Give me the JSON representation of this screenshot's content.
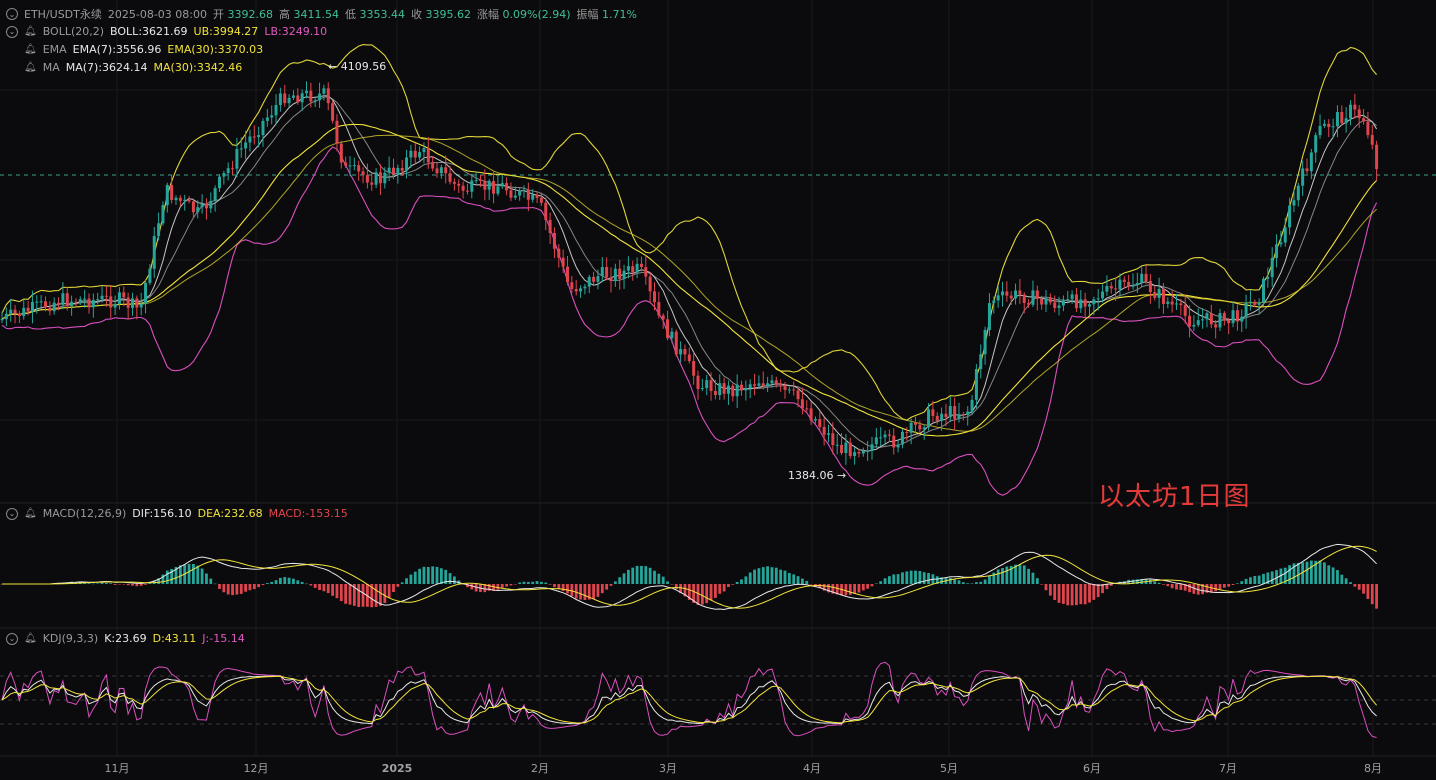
{
  "header": {
    "symbol": "ETH/USDT永续",
    "datetime": "2025-08-03 08:00",
    "open_label": "开",
    "open": "3392.68",
    "high_label": "高",
    "high": "3411.54",
    "low_label": "低",
    "low": "3353.44",
    "close_label": "收",
    "close": "3395.62",
    "change_label": "涨幅",
    "change": "0.09%(2.94)",
    "amplitude_label": "振幅",
    "amplitude": "1.71%"
  },
  "boll": {
    "name": "BOLL(20,2)",
    "mid": "BOLL:3621.69",
    "ub": "UB:3994.27",
    "lb": "LB:3249.10"
  },
  "ema": {
    "name": "EMA",
    "ema7": "EMA(7):3556.96",
    "ema30": "EMA(30):3370.03"
  },
  "ma": {
    "name": "MA",
    "ma7": "MA(7):3624.14",
    "ma30": "MA(30):3342.46"
  },
  "macd": {
    "name": "MACD(12,26,9)",
    "dif": "DIF:156.10",
    "dea": "DEA:232.68",
    "macd": "MACD:-153.15"
  },
  "kdj": {
    "name": "KDJ(9,3,3)",
    "k": "K:23.69",
    "d": "D:43.11",
    "j": "J:-15.14"
  },
  "annotations": {
    "high_mark": "4109.56",
    "low_mark": "1384.06",
    "overlay_title": "以太坊1日图"
  },
  "colors": {
    "up": "#26a69a",
    "down": "#e0454e",
    "boll_band": "#e0d43a",
    "boll_lower": "#d94fbf",
    "ma_fast": "#e8e8e8",
    "ema_slow": "#f2e33a"
  },
  "chart_data": {
    "type": "candlestick",
    "x_tick_labels": [
      "11月",
      "12月",
      "2025",
      "2月",
      "3月",
      "4月",
      "5月",
      "6月",
      "7月",
      "8月"
    ],
    "price_range": [
      1384.06,
      4109.56
    ],
    "series": [
      {
        "name": "ETH/USDT永续",
        "x": [
          "2024-10",
          "2024-11",
          "2024-12",
          "2025-01",
          "2025-02",
          "2025-03",
          "2025-04",
          "2025-05",
          "2025-06",
          "2025-07",
          "2025-08"
        ],
        "values": [
          2500,
          2400,
          3600,
          3300,
          2700,
          2200,
          1800,
          2500,
          2500,
          3700,
          3395.62
        ]
      }
    ]
  }
}
